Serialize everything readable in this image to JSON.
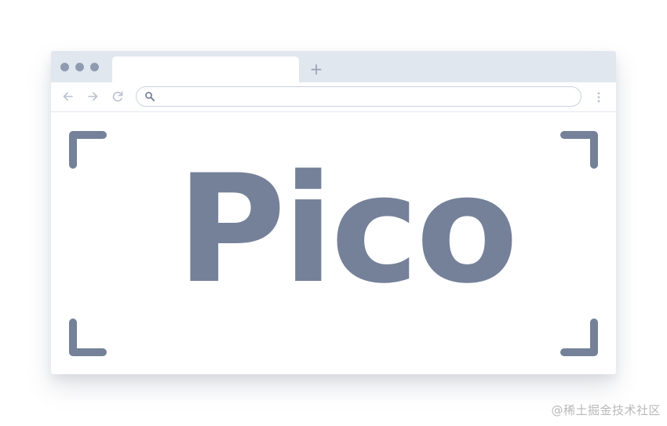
{
  "browser": {
    "tab_title": "",
    "new_tab_label": "+",
    "address_value": "",
    "address_placeholder": ""
  },
  "content": {
    "logo_text": "Pico"
  },
  "watermark": "@稀土掘金技术社区",
  "colors": {
    "chrome": "#e1e7ef",
    "window_dots": "#8f9bb1",
    "nav_icons": "#b9c1cf",
    "logo": "#748199",
    "watermark": "#b9b9b9"
  },
  "icons": [
    "back-arrow-icon",
    "forward-arrow-icon",
    "reload-icon",
    "search-icon",
    "more-vertical-icon",
    "corner-frame-icon"
  ]
}
